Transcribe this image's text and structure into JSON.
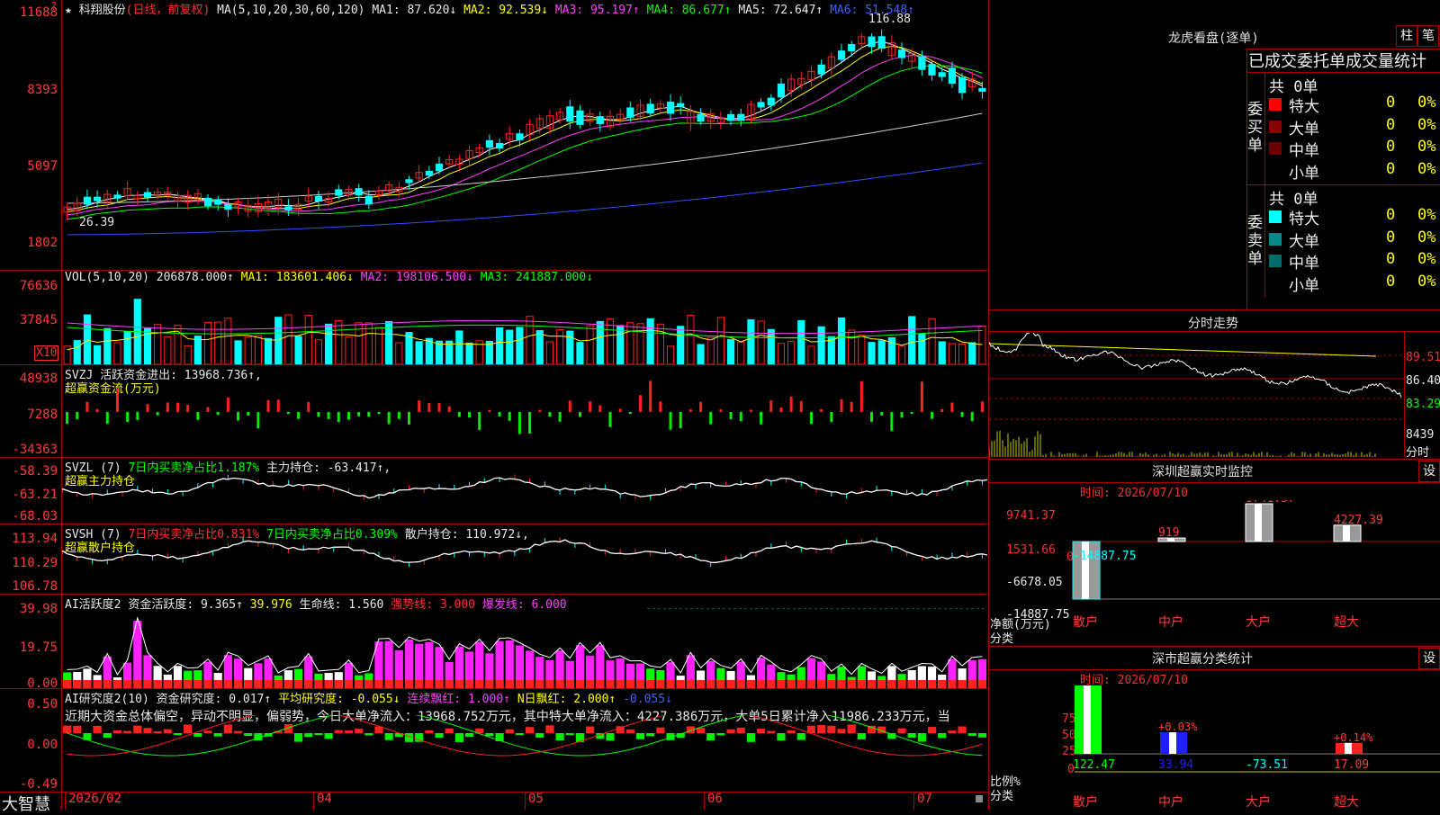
{
  "stock": {
    "name": "★ 科翔股份",
    "period": "(日线，前复权)"
  },
  "main_header": {
    "ma": "MA(5,10,20,30,60,120)",
    "ma1": "MA1: 87.620↓",
    "ma2": "MA2: 92.539↓",
    "ma3": "MA3: 95.197↑",
    "ma4": "MA4: 86.677↑",
    "ma5": "MA5: 72.647↑",
    "ma6": "MA6: 51.548↑"
  },
  "main_axis": [
    "11688",
    "8393",
    "5097",
    "1802"
  ],
  "main_marks": {
    "high": "116.88",
    "low": "26.39"
  },
  "vol_header": {
    "label": "VOL(5,10,20)",
    "val": "206878.000↑",
    "ma1": "MA1: 183601.406↓",
    "ma2": "MA2: 198106.500↓",
    "ma3": "MA3: 241887.000↓"
  },
  "vol_axis": [
    "76636",
    "37845"
  ],
  "vol_unit": "X10",
  "svzj": {
    "label": "SVZJ",
    "text": "活跃资金进出: 13968.736↑,",
    "sub": "超赢资金流(万元)",
    "axis": [
      "48938",
      "7288",
      "-34363"
    ]
  },
  "svzl": {
    "label": "SVZL (7)",
    "t1": "7日内买卖净占比1.187%",
    "t2": "主力持仓: -63.417↑,",
    "sub": "超赢主力持仓",
    "axis": [
      "-58.39",
      "-63.21",
      "-68.03"
    ]
  },
  "svsh": {
    "label": "SVSH (7)",
    "t1": "7日内买卖净占比0.831%",
    "t2": "7日内买卖净占比0.309%",
    "t3": "散户持仓: 110.972↓,",
    "sub": "超赢散户持仓",
    "axis": [
      "113.94",
      "110.29",
      "106.78"
    ]
  },
  "ai1": {
    "label": "AI活跃度2",
    "t1": "资金活跃度: 9.365↑",
    "t2": "39.976",
    "t3": "生命线: 1.560",
    "t4": "强势线: 3.000",
    "t5": "爆发线: 6.000",
    "axis": [
      "39.98",
      "19.75",
      "0.00"
    ]
  },
  "ai2": {
    "label": "AI研究度2(10)",
    "t1": "资金研究度: 0.017↑",
    "t2": "平均研究度: -0.055↓",
    "t3": "连续飘红: 1.000↑",
    "t4": "N日飘红: 2.000↑",
    "t5": "-0.055↓",
    "note": "近期大资金总体偏空，异动不明显，偏弱势，今日大单净流入：13968.752万元，其中特大单净流入：4227.386万元，大单5日累计净入11986.233万元，当",
    "axis": [
      "0.50",
      "0.00",
      "-0.49"
    ]
  },
  "xaxis": [
    "2026/02",
    "04",
    "05",
    "06",
    "07"
  ],
  "logo": "大智慧",
  "lhb": {
    "title": "龙虎看盘(逐单)",
    "btn1": "柱",
    "btn2": "笔",
    "tabs": "已成交委托单成交量统计",
    "buy_label": "委买单",
    "sell_label": "委卖单",
    "buy_total": "共 0单",
    "sell_total": "共 0单",
    "buy": [
      {
        "label": "特大",
        "n": "0",
        "p": "0%",
        "color": "#ff0000"
      },
      {
        "label": "大单",
        "n": "0",
        "p": "0%",
        "color": "#8b0000"
      },
      {
        "label": "中单",
        "n": "0",
        "p": "0%",
        "color": "#6a0000"
      },
      {
        "label": "小单",
        "n": "0",
        "p": "0%",
        "color": "#000000"
      }
    ],
    "sell": [
      {
        "label": "特大",
        "n": "0",
        "p": "0%",
        "color": "#00ffff"
      },
      {
        "label": "大单",
        "n": "0",
        "p": "0%",
        "color": "#008b8b"
      },
      {
        "label": "中单",
        "n": "0",
        "p": "0%",
        "color": "#006d6d"
      },
      {
        "label": "小单",
        "n": "0",
        "p": "0%",
        "color": "#000000"
      }
    ]
  },
  "fenshi": {
    "title": "分时走势",
    "axis": [
      "89.51",
      "86.40",
      "83.29",
      "8439"
    ],
    "unit": "分时"
  },
  "sz_monitor": {
    "title": "深圳超赢实时监控",
    "btn": "设",
    "time": "时间: 2026/07/10",
    "axis": [
      "9741.37",
      "1531.66",
      "0",
      "-6678.05",
      "-14887.75"
    ],
    "ylabel": "净额(万元)",
    "xlabel": "分类",
    "chart_data": {
      "type": "bar",
      "categories": [
        "散户",
        "中户",
        "大户",
        "超大"
      ],
      "values": [
        -14887.75,
        919,
        9741.37,
        4227.39
      ],
      "labels": [
        "-14887.75",
        "919",
        "9741.37",
        "4227.39"
      ],
      "ylim": [
        -14887.75,
        9741.37
      ]
    }
  },
  "sz_stats": {
    "title": "深市超赢分类统计",
    "btn": "设",
    "time": "时间: 2026/07/10",
    "axis": [
      "75",
      "50",
      "25",
      "0"
    ],
    "ylabel": "比例%",
    "xlabel": "分类",
    "chart_data": {
      "type": "bar",
      "categories": [
        "散户",
        "中户",
        "大户",
        "超大"
      ],
      "values": [
        100,
        31.5,
        0,
        16
      ],
      "labels": [
        "",
        "+0.03%",
        "",
        "+0.14%"
      ],
      "bottom_values": [
        "122.47",
        "33.94",
        "-73.51",
        "17.09"
      ]
    }
  }
}
